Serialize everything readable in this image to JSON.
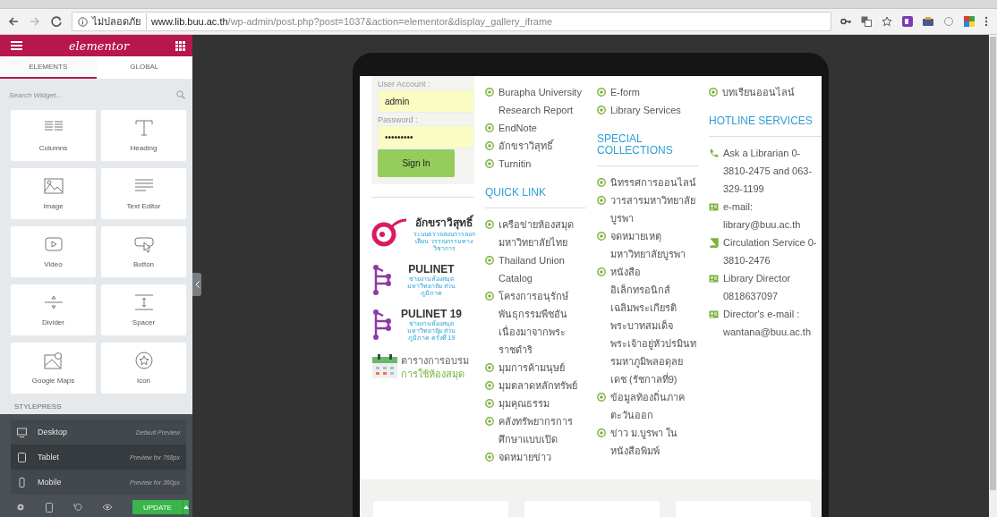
{
  "browser": {
    "security_label": "ไม่ปลอดภัย",
    "url_host": "www.lib.buu.ac.th",
    "url_path": "/wp-admin/post.php?post=1037&action=elementor&display_gallery_iframe"
  },
  "editor": {
    "logo": "elementor",
    "tabs": [
      {
        "label": "ELEMENTS",
        "selected": true
      },
      {
        "label": "GLOBAL",
        "selected": false
      }
    ],
    "search_placeholder": "Search Widget...",
    "widgets": [
      {
        "kind": "columns",
        "label": "Columns"
      },
      {
        "kind": "heading",
        "label": "Heading"
      },
      {
        "kind": "image",
        "label": "Image"
      },
      {
        "kind": "text",
        "label": "Text Editor"
      },
      {
        "kind": "video",
        "label": "Video"
      },
      {
        "kind": "button",
        "label": "Button"
      },
      {
        "kind": "divider",
        "label": "Divider"
      },
      {
        "kind": "spacer",
        "label": "Spacer"
      },
      {
        "kind": "map",
        "label": "Google Maps"
      },
      {
        "kind": "star",
        "label": "Icon"
      }
    ],
    "section_label": "STYLEPRESS",
    "devices": [
      {
        "kind": "desktop",
        "label": "Desktop",
        "hint": "Default Preview",
        "selected": false
      },
      {
        "kind": "tablet",
        "label": "Tablet",
        "hint": "Preview for 768px",
        "selected": true
      },
      {
        "kind": "mobile",
        "label": "Mobile",
        "hint": "Preview for 360px",
        "selected": false
      }
    ],
    "update_button": "UPDATE"
  },
  "preview": {
    "login": {
      "user_label": "User Account :",
      "user_value": "admin",
      "password_label": "Password :",
      "password_value": "•••••••••",
      "button": "Sign In"
    },
    "badges": [
      {
        "kind": "akkhara",
        "title": "อักขราวิสุทธิ์",
        "subtitle": "ระบบตรวจสอบการลอกเลียน วรรณกรรมทางวิชาการ"
      },
      {
        "kind": "pulinet",
        "title": "PULINET",
        "subtitle": "ข่ายงานห้องสมุดมหาวิทยาลัย ส่วนภูมิภาค"
      },
      {
        "kind": "pulinet",
        "title": "PULINET 19",
        "subtitle": "ข่ายงานห้องสมุดมหาวิทยาลัย ส่วนภูมิภาค ครั้งที่ 19"
      },
      {
        "kind": "calendar",
        "title": "ตารางการอบรม",
        "subtitle": "การใช้ห้องสมุด"
      }
    ],
    "columns": [
      {
        "groups": [
          {
            "items": [
              "Burapha University Research Report",
              "EndNote",
              "อักขราวิสุทธิ์",
              "Turnitin"
            ]
          },
          {
            "heading": "QUICK LINK",
            "items": [
              "เครือข่ายห้องสมุดมหาวิทยาลัยไทย",
              "Thailand Union Catalog",
              "โครงการอนุรักษ์พันธุกรรมพืชอันเนื่องมาจากพระราชดำริ",
              "มุมการค้ามนุษย์",
              "มุมตลาดหลักทรัพย์",
              "มุมคุณธรรม",
              "คลังทรัพยากรการศึกษาแบบเปิด",
              "จดหมายข่าว"
            ]
          }
        ]
      },
      {
        "groups": [
          {
            "items": [
              "E-form",
              "Library Services"
            ]
          },
          {
            "heading": "SPECIAL COLLECTIONS",
            "items": [
              "นิทรรศการออนไลน์",
              "วารสารมหาวิทยาลัยบูรพา",
              "จดหมายเหตุมหาวิทยาลัยบูรพา",
              "หนังสืออิเล็กทรอนิกส์เฉลิมพระเกียรติพระบาทสมเด็จพระเจ้าอยู่หัวปรมินทรมหาภูมิพลอดุลยเดช (รัชกาลที่9)",
              "ข้อมูลท้องถิ่นภาคตะวันออก",
              "ข่าว ม.บูรพา ในหนังสือพิมพ์"
            ]
          }
        ]
      },
      {
        "groups": [
          {
            "items": [
              "บทเรียนออนไลน์"
            ]
          },
          {
            "heading": "HOTLINE SERVICES",
            "contacts": [
              {
                "kind": "phone",
                "text": "Ask a Librarian 0-3810-2475 and 063-329-1199"
              },
              {
                "kind": "card",
                "text": "e-mail: library@buu.ac.th"
              },
              {
                "kind": "book",
                "text": "Circulation Service 0-3810-2476"
              },
              {
                "kind": "card",
                "text": "Library Director 0818637097"
              },
              {
                "kind": "card",
                "text": "Director's e-mail : wantana@buu.ac.th"
              }
            ]
          }
        ]
      }
    ]
  }
}
